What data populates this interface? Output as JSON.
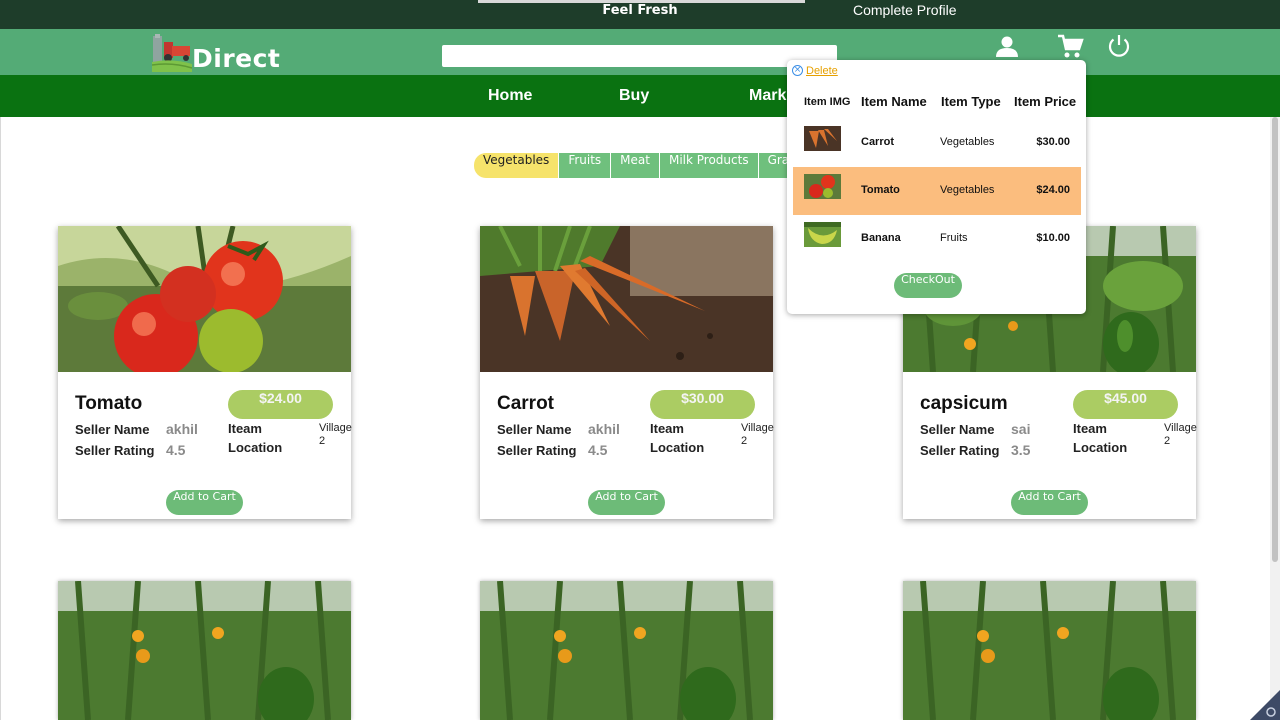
{
  "topbar": {
    "tagline": "Feel Fresh",
    "complete_profile": "Complete Profile"
  },
  "header": {
    "logo_text": "Direct",
    "search_value": "",
    "icons": [
      "user-icon",
      "cart-icon",
      "power-icon"
    ]
  },
  "nav": {
    "items": [
      "Home",
      "Buy",
      "Mark"
    ]
  },
  "categories": [
    "Vegetables",
    "Fruits",
    "Meat",
    "Milk Products",
    "Grains"
  ],
  "labels": {
    "seller_name": "Seller Name",
    "seller_rating": "Seller Rating",
    "item_location_1": "Iteam",
    "item_location_2": "Location",
    "add_to_cart": "Add to Cart"
  },
  "products": [
    {
      "name": "Tomato",
      "price": "$24.00",
      "seller": "akhil",
      "rating": "4.5",
      "location": "Village 2",
      "image": "tomato"
    },
    {
      "name": "Carrot",
      "price": "$30.00",
      "seller": "akhil",
      "rating": "4.5",
      "location": "Village 2",
      "image": "carrot"
    },
    {
      "name": "capsicum",
      "price": "$45.00",
      "seller": "sai",
      "rating": "3.5",
      "location": "Village 2",
      "image": "capsicum"
    }
  ],
  "cart": {
    "delete_label": "Delete",
    "headers": [
      "Item IMG",
      "Item Name",
      "Item Type",
      "Item Price"
    ],
    "rows": [
      {
        "name": "Carrot",
        "type": "Vegetables",
        "price": "$30.00",
        "highlighted": false
      },
      {
        "name": "Tomato",
        "type": "Vegetables",
        "price": "$24.00",
        "highlighted": true
      },
      {
        "name": "Banana",
        "type": "Fruits",
        "price": "$10.00",
        "highlighted": false
      }
    ],
    "checkout_label": "CheckOut"
  },
  "colors": {
    "topbar": "#1e3d2a",
    "header": "#54ab76",
    "nav": "#0a7211",
    "price_pill": "#abcc63",
    "button": "#6dbb78",
    "highlight_row": "#fbbd7e",
    "active_category": "#f6e36b"
  }
}
